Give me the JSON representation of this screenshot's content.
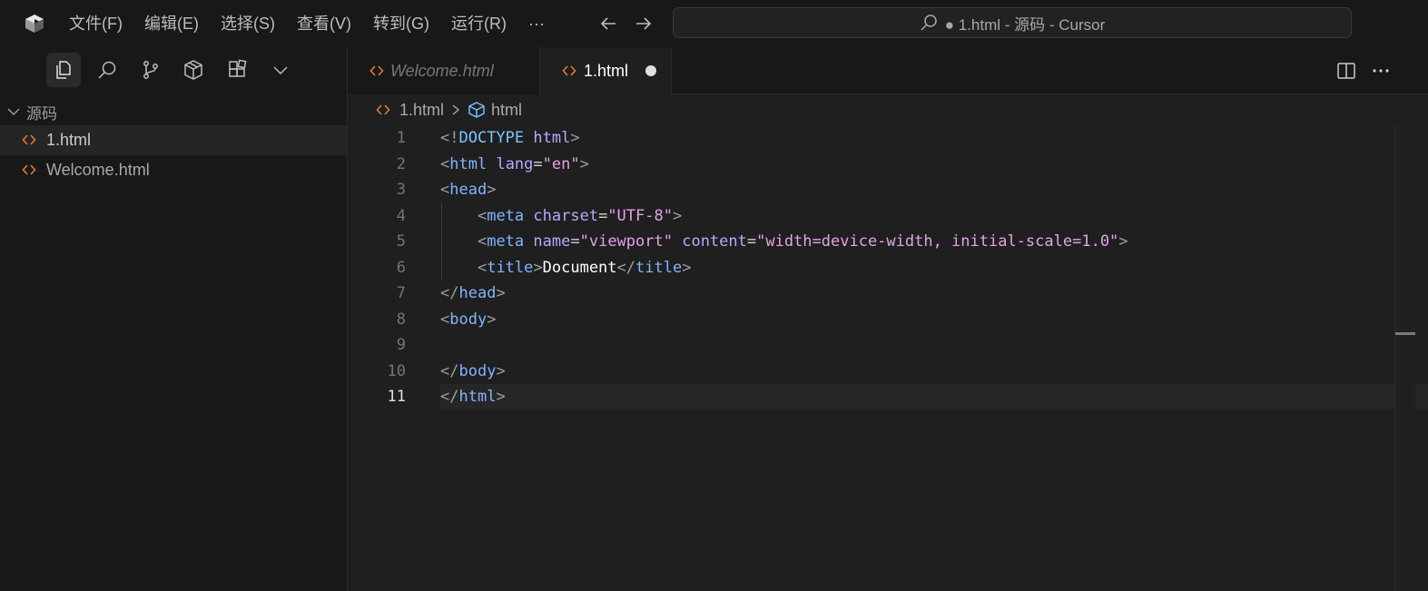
{
  "titlebar": {
    "menu": [
      "文件(F)",
      "编辑(E)",
      "选择(S)",
      "查看(V)",
      "转到(G)",
      "运行(R)",
      "···"
    ],
    "search_text": "● 1.html - 源码 - Cursor"
  },
  "sidebar": {
    "activity_icons": [
      "files-icon",
      "search-icon",
      "source-control-icon",
      "extensions-box-icon",
      "extensions-icon",
      "chevron-down-icon"
    ],
    "section_title": "源码",
    "files": [
      {
        "label": "1.html",
        "selected": true
      },
      {
        "label": "Welcome.html",
        "selected": false
      }
    ]
  },
  "tabs": [
    {
      "label": "Welcome.html",
      "active": false
    },
    {
      "label": "1.html",
      "active": true,
      "dirty": true
    }
  ],
  "breadcrumb": {
    "file": "1.html",
    "symbol": "html"
  },
  "editor": {
    "current_line": 11,
    "line_numbers": [
      "1",
      "2",
      "3",
      "4",
      "5",
      "6",
      "7",
      "8",
      "9",
      "10",
      "11"
    ],
    "lines": [
      "<!DOCTYPE html>",
      "<html lang=\"en\">",
      "<head>",
      "    <meta charset=\"UTF-8\">",
      "    <meta name=\"viewport\" content=\"width=device-width, initial-scale=1.0\">",
      "    <title>Document</title>",
      "</head>",
      "<body>",
      "",
      "</body>",
      "</html>"
    ]
  },
  "colors": {
    "background": "#181818",
    "editor_bg": "#1f1f1f",
    "html_icon": "#e37933",
    "tag": "#82b4ff",
    "attr": "#b9a8ff",
    "string": "#e3a1e8"
  }
}
